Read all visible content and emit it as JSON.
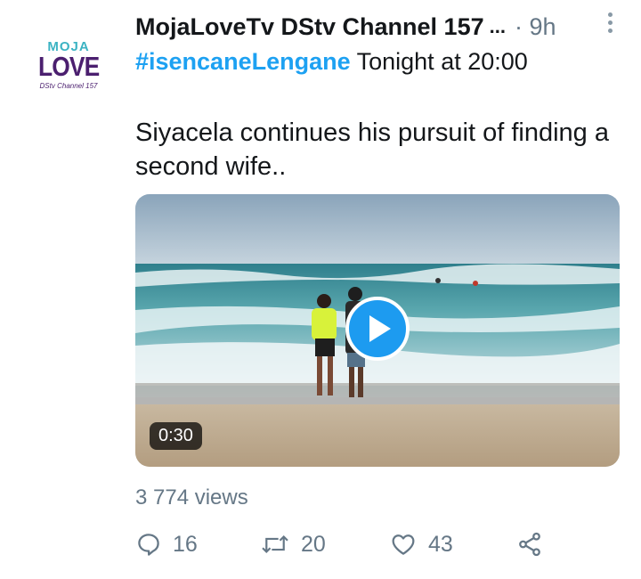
{
  "tweet": {
    "avatar": {
      "line1": "MOJA",
      "line2": "LOVE",
      "line3": "DStv Channel 157"
    },
    "author_name": "MojaLoveTv DStv Channel 157",
    "truncation": "...",
    "time": "· 9h",
    "hashtag": "#isencaneLengane",
    "hashtag_rest": " Tonight at 20:00",
    "body": "Siyacela continues his pursuit of finding a second wife..",
    "video": {
      "duration": "0:30"
    },
    "views": "3 774 views",
    "actions": {
      "replies": "16",
      "retweets": "20",
      "likes": "43"
    }
  },
  "icons": [
    "more-icon",
    "play-icon",
    "reply-icon",
    "retweet-icon",
    "like-icon",
    "share-icon"
  ],
  "colors": {
    "link": "#1da1f2",
    "muted": "#657786",
    "play": "#1d9bf0"
  }
}
